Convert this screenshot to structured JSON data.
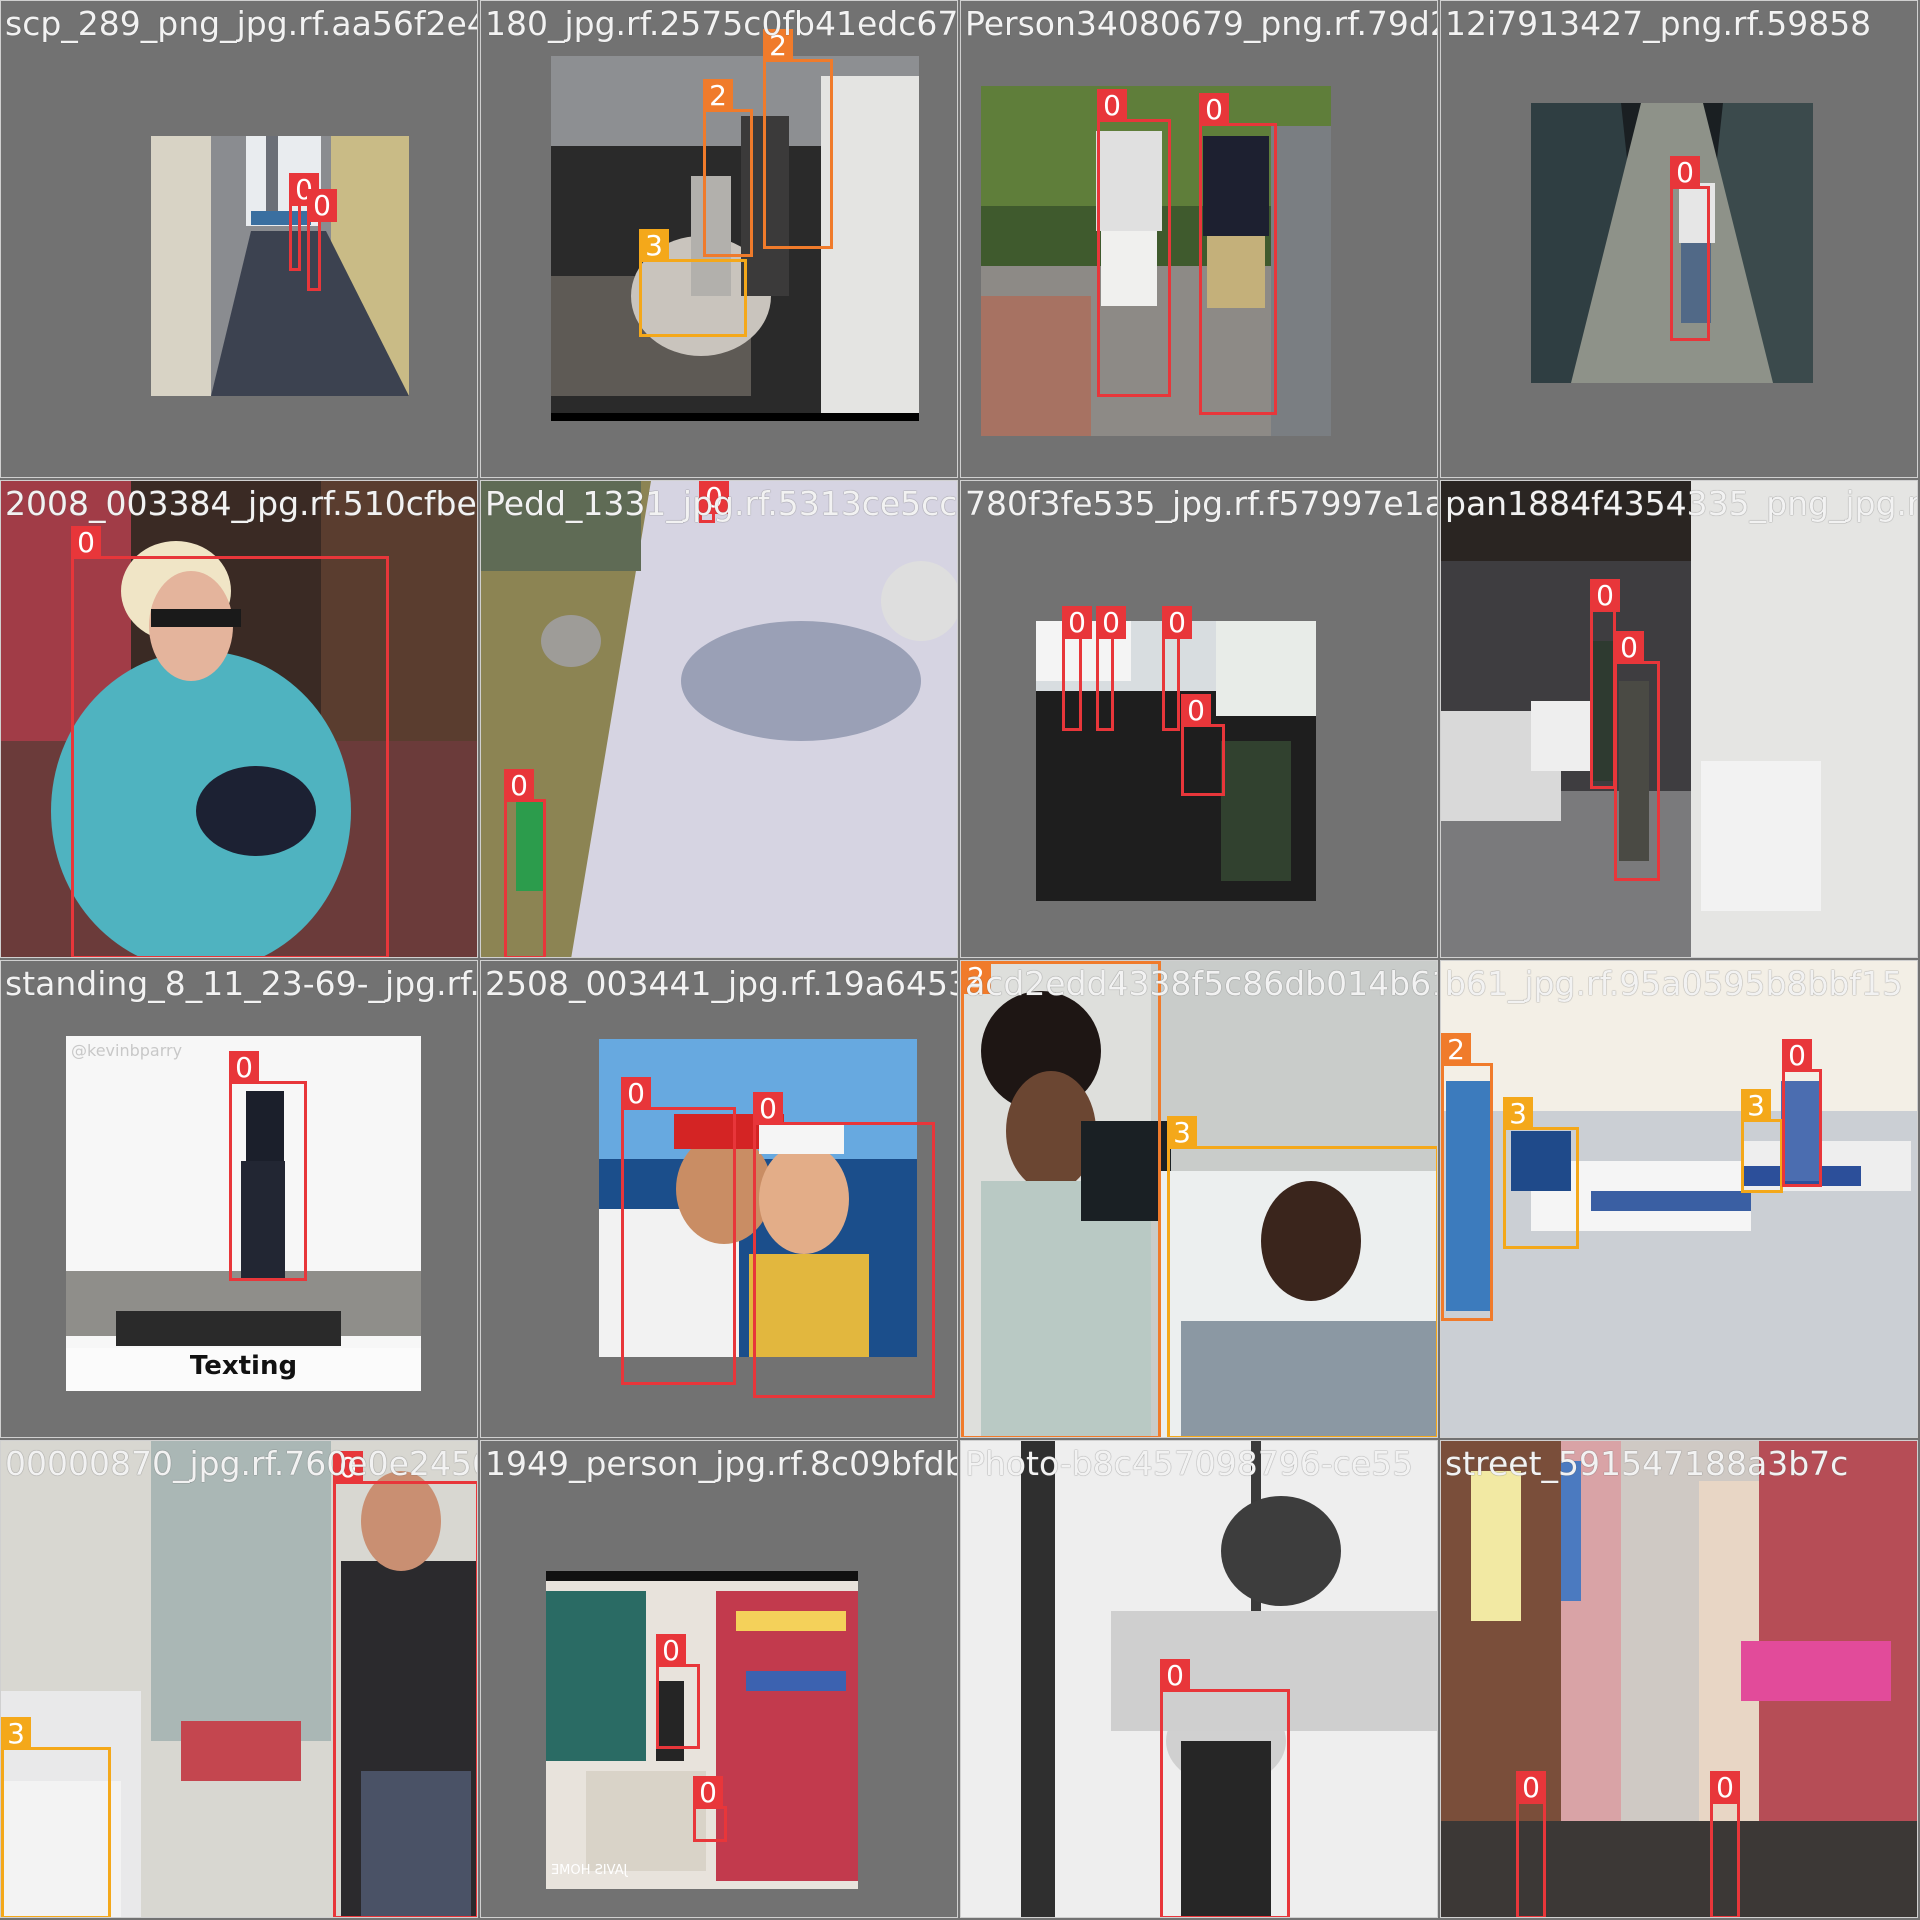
{
  "classes": {
    "0": {
      "name": "",
      "color": "#e8363a"
    },
    "2": {
      "name": "",
      "color": "#f07b2b"
    },
    "3": {
      "name": "",
      "color": "#f4a81a"
    }
  },
  "tiles": [
    {
      "file": "scp_289_png_jpg.rf.aa56f2e480ebf2067a9f9b41edc671",
      "scene": "alley",
      "detections": [
        {
          "label": "0"
        },
        {
          "label": "0"
        }
      ]
    },
    {
      "file": "180_jpg.rf.2575c0fb41edc671d8efa73402679",
      "scene": "ambulance",
      "detections": [
        {
          "label": "2"
        },
        {
          "label": "2"
        },
        {
          "label": "3"
        }
      ]
    },
    {
      "file": "Person34080679_png.rf.79d21d0ff83f57eeeb7f",
      "scene": "walkers",
      "detections": [
        {
          "label": "0"
        },
        {
          "label": "0"
        }
      ]
    },
    {
      "file": "12i7913427_png.rf.59858",
      "scene": "corridor",
      "detections": [
        {
          "label": "0"
        }
      ]
    },
    {
      "file": "2008_003384_jpg.rf.510cfbe8bd7383b1f3f5",
      "scene": "woman",
      "detections": [
        {
          "label": "0"
        }
      ]
    },
    {
      "file": "Pedd_1331_jpg.rf.5313ce5cc780f3f3e535",
      "scene": "path",
      "detections": [
        {
          "label": "0"
        },
        {
          "label": "0"
        }
      ]
    },
    {
      "file": "780f3fe535_jpg.rf.f57997e1a1e9e4a254335",
      "scene": "busstop",
      "detections": [
        {
          "label": "0"
        },
        {
          "label": "0"
        },
        {
          "label": "0"
        },
        {
          "label": "0"
        }
      ]
    },
    {
      "file": "pan1884f4354335_png_jpg.rf.056",
      "scene": "office",
      "detections": [
        {
          "label": "0"
        },
        {
          "label": "0"
        }
      ]
    },
    {
      "file": "standing_8_11_23-69-_jpg.rf.2f568700d1343",
      "scene": "treadmill",
      "caption": "Texting",
      "watermark": "@kevinbparry",
      "detections": [
        {
          "label": "0"
        }
      ]
    },
    {
      "file": "2508_003441_jpg.rf.19a6453acd2edd4338f5c86db014b",
      "scene": "boat",
      "detections": [
        {
          "label": "0"
        },
        {
          "label": "0"
        }
      ]
    },
    {
      "file": "acd2edd4338f5c86db014b61",
      "scene": "icu",
      "detections": [
        {
          "label": "2"
        },
        {
          "label": "3"
        }
      ]
    },
    {
      "file": "b61_jpg.rf.95a0595b8bbf15",
      "scene": "ward",
      "detections": [
        {
          "label": "2"
        },
        {
          "label": "3"
        },
        {
          "label": "3"
        },
        {
          "label": "0"
        }
      ]
    },
    {
      "file": "00000870_jpg.rf.760e0e2456d49d5eff626333",
      "scene": "hospital",
      "detections": [
        {
          "label": "0"
        },
        {
          "label": "3"
        }
      ]
    },
    {
      "file": "1949_person_jpg.rf.8c09bfdb4e1b8c4570",
      "scene": "shop",
      "video_text": "JAVIS HOME",
      "detections": [
        {
          "label": "0"
        },
        {
          "label": "0"
        }
      ]
    },
    {
      "file": "Photo-b8c457098796-ce55",
      "scene": "snow",
      "detections": [
        {
          "label": "0"
        }
      ]
    },
    {
      "file": "street_591547188a3b7c",
      "scene": "city",
      "detections": [
        {
          "label": "0"
        },
        {
          "label": "0"
        }
      ]
    }
  ]
}
